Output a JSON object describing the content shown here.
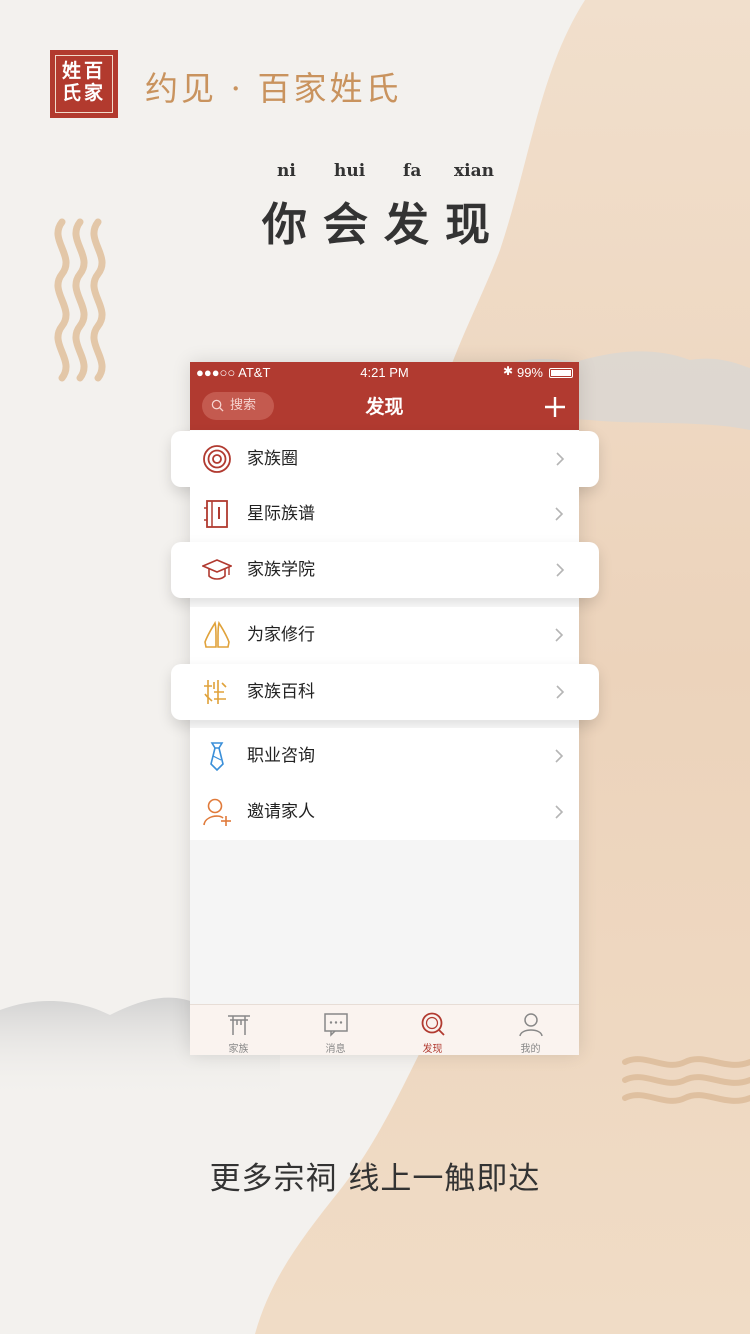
{
  "brand": {
    "seal_chars": [
      "百",
      "家",
      "姓",
      "氏"
    ],
    "name": "约见 · 百家姓氏"
  },
  "heading": {
    "pinyin": [
      "ni",
      "hui",
      "fa",
      "xian"
    ],
    "title": "你会发现"
  },
  "phone": {
    "status_bar": {
      "carrier": "●●●○○ AT&T",
      "time": "4:21 PM",
      "battery": "99%"
    },
    "nav": {
      "search_placeholder": "搜索",
      "title": "发现"
    },
    "menu": [
      {
        "label": "家族圈",
        "icon": "family-circle-icon",
        "color": "#b13a30"
      },
      {
        "label": "星际族谱",
        "icon": "genealogy-book-icon",
        "color": "#b13a30"
      },
      {
        "label": "家族学院",
        "icon": "graduation-cap-icon",
        "color": "#b13a30"
      },
      {
        "label": "为家修行",
        "icon": "praying-hands-icon",
        "color": "#e0a23a"
      },
      {
        "label": "家族百科",
        "icon": "surname-glyph-icon",
        "color": "#e0a23a"
      },
      {
        "label": "职业咨询",
        "icon": "necktie-icon",
        "color": "#3a8fd9"
      },
      {
        "label": "邀请家人",
        "icon": "add-person-icon",
        "color": "#e07a3a"
      }
    ],
    "tabs": [
      {
        "label": "家族",
        "icon": "ancestral-gate-icon"
      },
      {
        "label": "消息",
        "icon": "message-icon"
      },
      {
        "label": "发现",
        "icon": "discover-icon",
        "active": true
      },
      {
        "label": "我的",
        "icon": "profile-icon"
      }
    ]
  },
  "slogan": "更多宗祠 线上一触即达",
  "colors": {
    "accent": "#b13a30",
    "gold": "#c9935e",
    "background": "#f3f1ee"
  }
}
